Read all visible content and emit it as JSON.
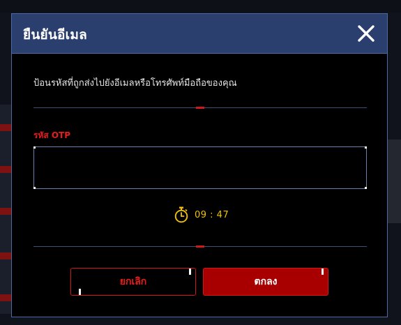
{
  "dialog": {
    "title": "ยืนยันอีเมล",
    "instruction": "ป้อนรหัสที่ถูกส่งไปยังอีเมลหรือโทรศัพท์มือถือของคุณ",
    "otp_label": "รหัส OTP",
    "otp_value": "",
    "otp_placeholder": "",
    "timer": "09 : 47",
    "cancel_label": "ยกเลิก",
    "ok_label": "ตกลง"
  },
  "icons": {
    "close": "close-icon",
    "timer": "stopwatch-icon"
  },
  "colors": {
    "header_bg": "#2b3f6e",
    "border": "#4c6aa6",
    "accent_red": "#e81c1c",
    "ok_button_bg": "#a80000",
    "timer_yellow": "#f2c200"
  }
}
